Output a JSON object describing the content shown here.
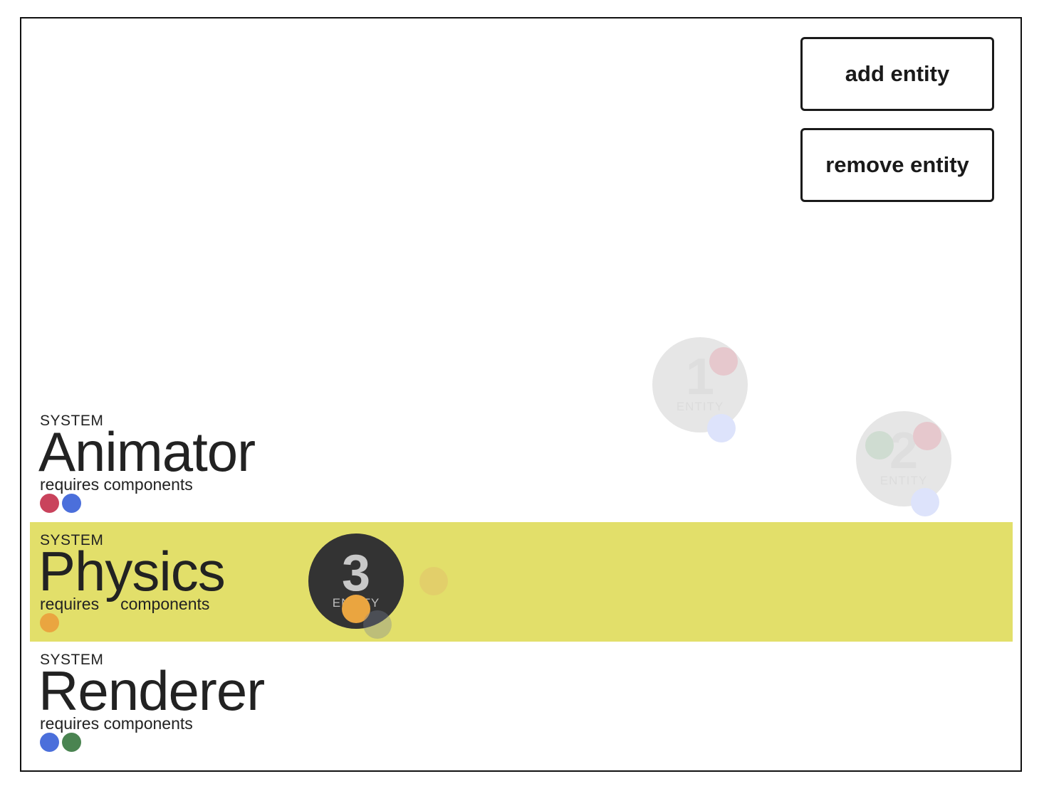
{
  "toolbar": {
    "add_label": "add entity",
    "remove_label": "remove entity"
  },
  "systems": [
    {
      "caption": "SYSTEM",
      "name": "Animator",
      "requires": "requires components",
      "highlighted": false,
      "components": [
        "#c9435c",
        "#4b6fdb"
      ]
    },
    {
      "caption": "SYSTEM",
      "name": "Physics",
      "requires_a": "requires",
      "requires_b": "components",
      "highlighted": true,
      "highlight_color": "#e2df6a",
      "components": [
        "#eaa540"
      ]
    },
    {
      "caption": "SYSTEM",
      "name": "Renderer",
      "requires": "requires components",
      "highlighted": false,
      "components": [
        "#4b6fdb",
        "#4a8451"
      ]
    }
  ],
  "entities": [
    {
      "number": "1",
      "label": "ENTITY",
      "state": "faded"
    },
    {
      "number": "2",
      "label": "ENTITY",
      "state": "faded"
    },
    {
      "number": "3",
      "label": "ENTITY",
      "state": "active"
    }
  ],
  "component_colors": {
    "red": "#c9435c",
    "blue": "#4b6fdb",
    "green": "#4a8451",
    "orange": "#eaa540"
  }
}
